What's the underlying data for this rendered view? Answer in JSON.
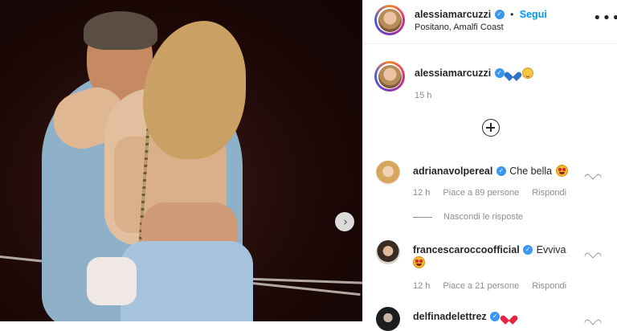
{
  "post": {
    "username": "alessiamarcuzzi",
    "follow_label": "Segui",
    "location": "Positano, Amalfi Coast",
    "caption_time": "15 h",
    "more_label": "•••"
  },
  "comments": [
    {
      "username": "adrianavolpereal",
      "text": "Che bella",
      "emoji": "star-struck",
      "time": "12 h",
      "likes": "Piace a 89 persone",
      "reply": "Rispondi"
    },
    {
      "username": "francescaroccoofficial",
      "text": "Evviva",
      "emoji": "star-struck",
      "time": "12 h",
      "likes": "Piace a 21 persone",
      "reply": "Rispondi"
    },
    {
      "username": "delfinadelettrez",
      "text": "",
      "emoji": "red-heart"
    }
  ],
  "hide_replies_label": "Nascondi le risposte",
  "colors": {
    "verified": "#3897f0",
    "follow": "#0095f6",
    "muted": "#8e8e8e"
  }
}
